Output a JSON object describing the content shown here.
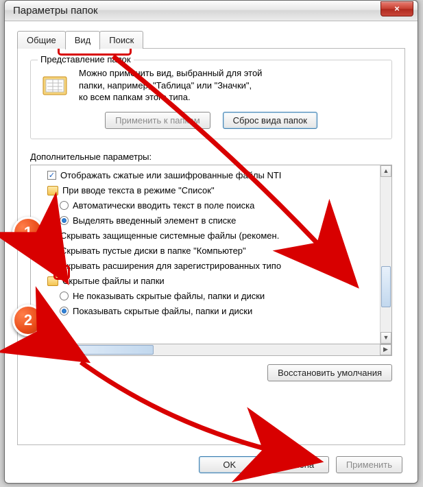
{
  "window": {
    "title": "Параметры папок",
    "close_label": "×"
  },
  "tabs": {
    "general": "Общие",
    "view": "Вид",
    "search": "Поиск"
  },
  "folder_views": {
    "group_title": "Представление папок",
    "desc_line1": "Можно применить вид, выбранный для этой",
    "desc_line2": "папки, например, \"Таблица\" или \"Значки\",",
    "desc_line3": "ко всем папкам этого типа.",
    "apply_btn": "Применить к папкам",
    "reset_btn": "Сброс вида папок"
  },
  "advanced": {
    "label": "Дополнительные параметры:",
    "items": [
      {
        "type": "check",
        "checked": true,
        "label": "Отображать сжатые или зашифрованные файлы NTI"
      },
      {
        "type": "folder",
        "label": "При вводе текста в режиме \"Список\""
      },
      {
        "type": "radio",
        "checked": false,
        "label": "Автоматически вводить текст в поле поиска"
      },
      {
        "type": "radio",
        "checked": true,
        "label": "Выделять введенный элемент в списке"
      },
      {
        "type": "check",
        "checked": false,
        "label": "Скрывать защищенные системные файлы (рекомен."
      },
      {
        "type": "check",
        "checked": true,
        "label": "Скрывать пустые диски в папке \"Компьютер\""
      },
      {
        "type": "check",
        "checked": false,
        "label": "Скрывать расширения для зарегистрированных типо"
      },
      {
        "type": "folder",
        "label": "Скрытые файлы и папки"
      },
      {
        "type": "radio",
        "checked": false,
        "label": "Не показывать скрытые файлы, папки и диски"
      },
      {
        "type": "radio",
        "checked": true,
        "label": "Показывать скрытые файлы, папки и диски"
      }
    ],
    "restore_btn": "Восстановить умолчания"
  },
  "buttons": {
    "ok": "OK",
    "cancel": "Отмена",
    "apply": "Применить"
  },
  "annotations": {
    "b1": "1",
    "b2": "2"
  }
}
